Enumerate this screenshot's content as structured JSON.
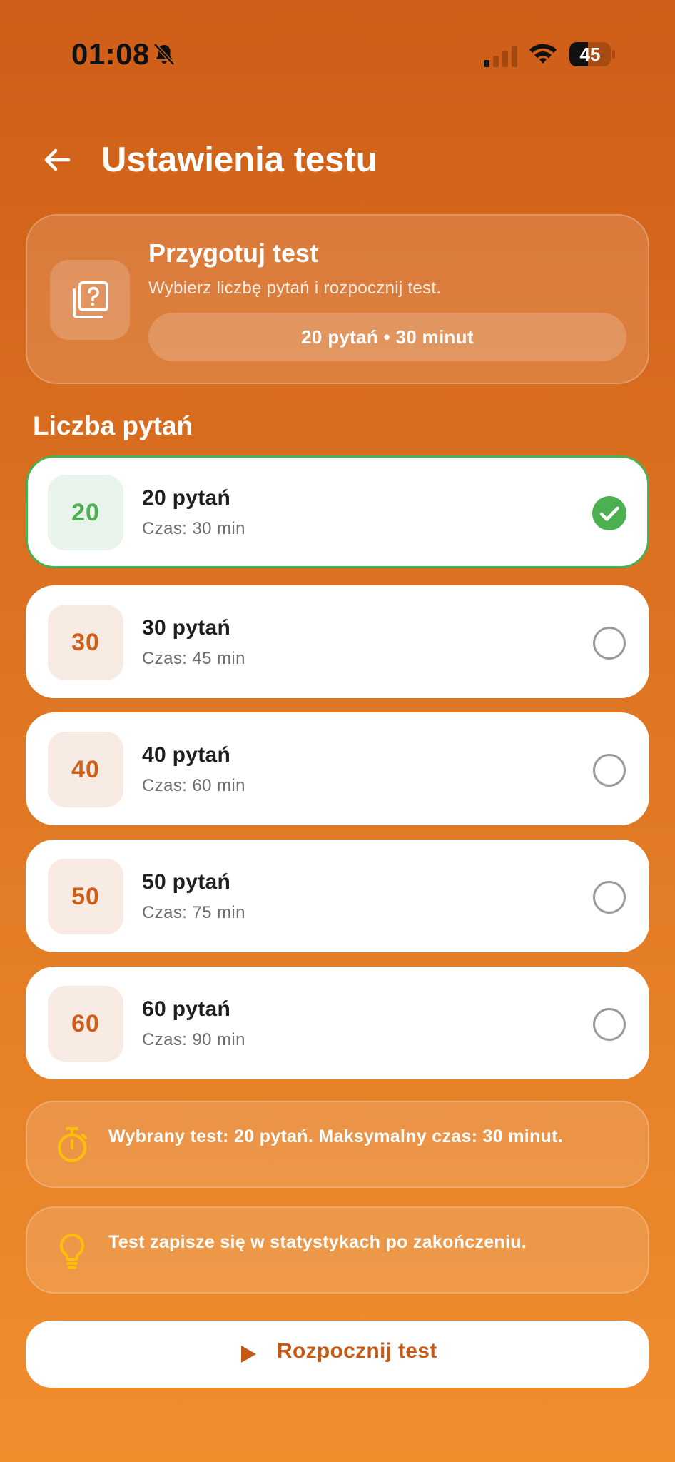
{
  "status_bar": {
    "time": "01:08",
    "battery": "45",
    "battery_level": 0.45
  },
  "header": {
    "title": "Ustawienia testu"
  },
  "intro": {
    "title": "Przygotuj test",
    "subtitle": "Wybierz liczbę pytań i rozpocznij test.",
    "summary": "20 pytań • 30 minut"
  },
  "section": {
    "label": "Liczba pytań"
  },
  "options": [
    {
      "badge": "20",
      "title": "20 pytań",
      "subtitle": "Czas: 30 min",
      "selected": true
    },
    {
      "badge": "30",
      "title": "30 pytań",
      "subtitle": "Czas: 45 min",
      "selected": false
    },
    {
      "badge": "40",
      "title": "40 pytań",
      "subtitle": "Czas: 60 min",
      "selected": false
    },
    {
      "badge": "50",
      "title": "50 pytań",
      "subtitle": "Czas: 75 min",
      "selected": false
    },
    {
      "badge": "60",
      "title": "60 pytań",
      "subtitle": "Czas: 90 min",
      "selected": false
    }
  ],
  "info": {
    "timer_text": "Wybrany test: 20 pytań. Maksymalny czas: 30 minut.",
    "timer_icon": "timer-icon",
    "tip_text": "Test zapisze się w statystykach po zakończeniu.",
    "tip_icon": "lightbulb-icon"
  },
  "start_button": {
    "label": "Rozpocznij test",
    "icon": "play-icon"
  },
  "colors": {
    "accent": "#CF5E18",
    "selected": "#4CAF50",
    "info_icon": "#FFC107"
  }
}
